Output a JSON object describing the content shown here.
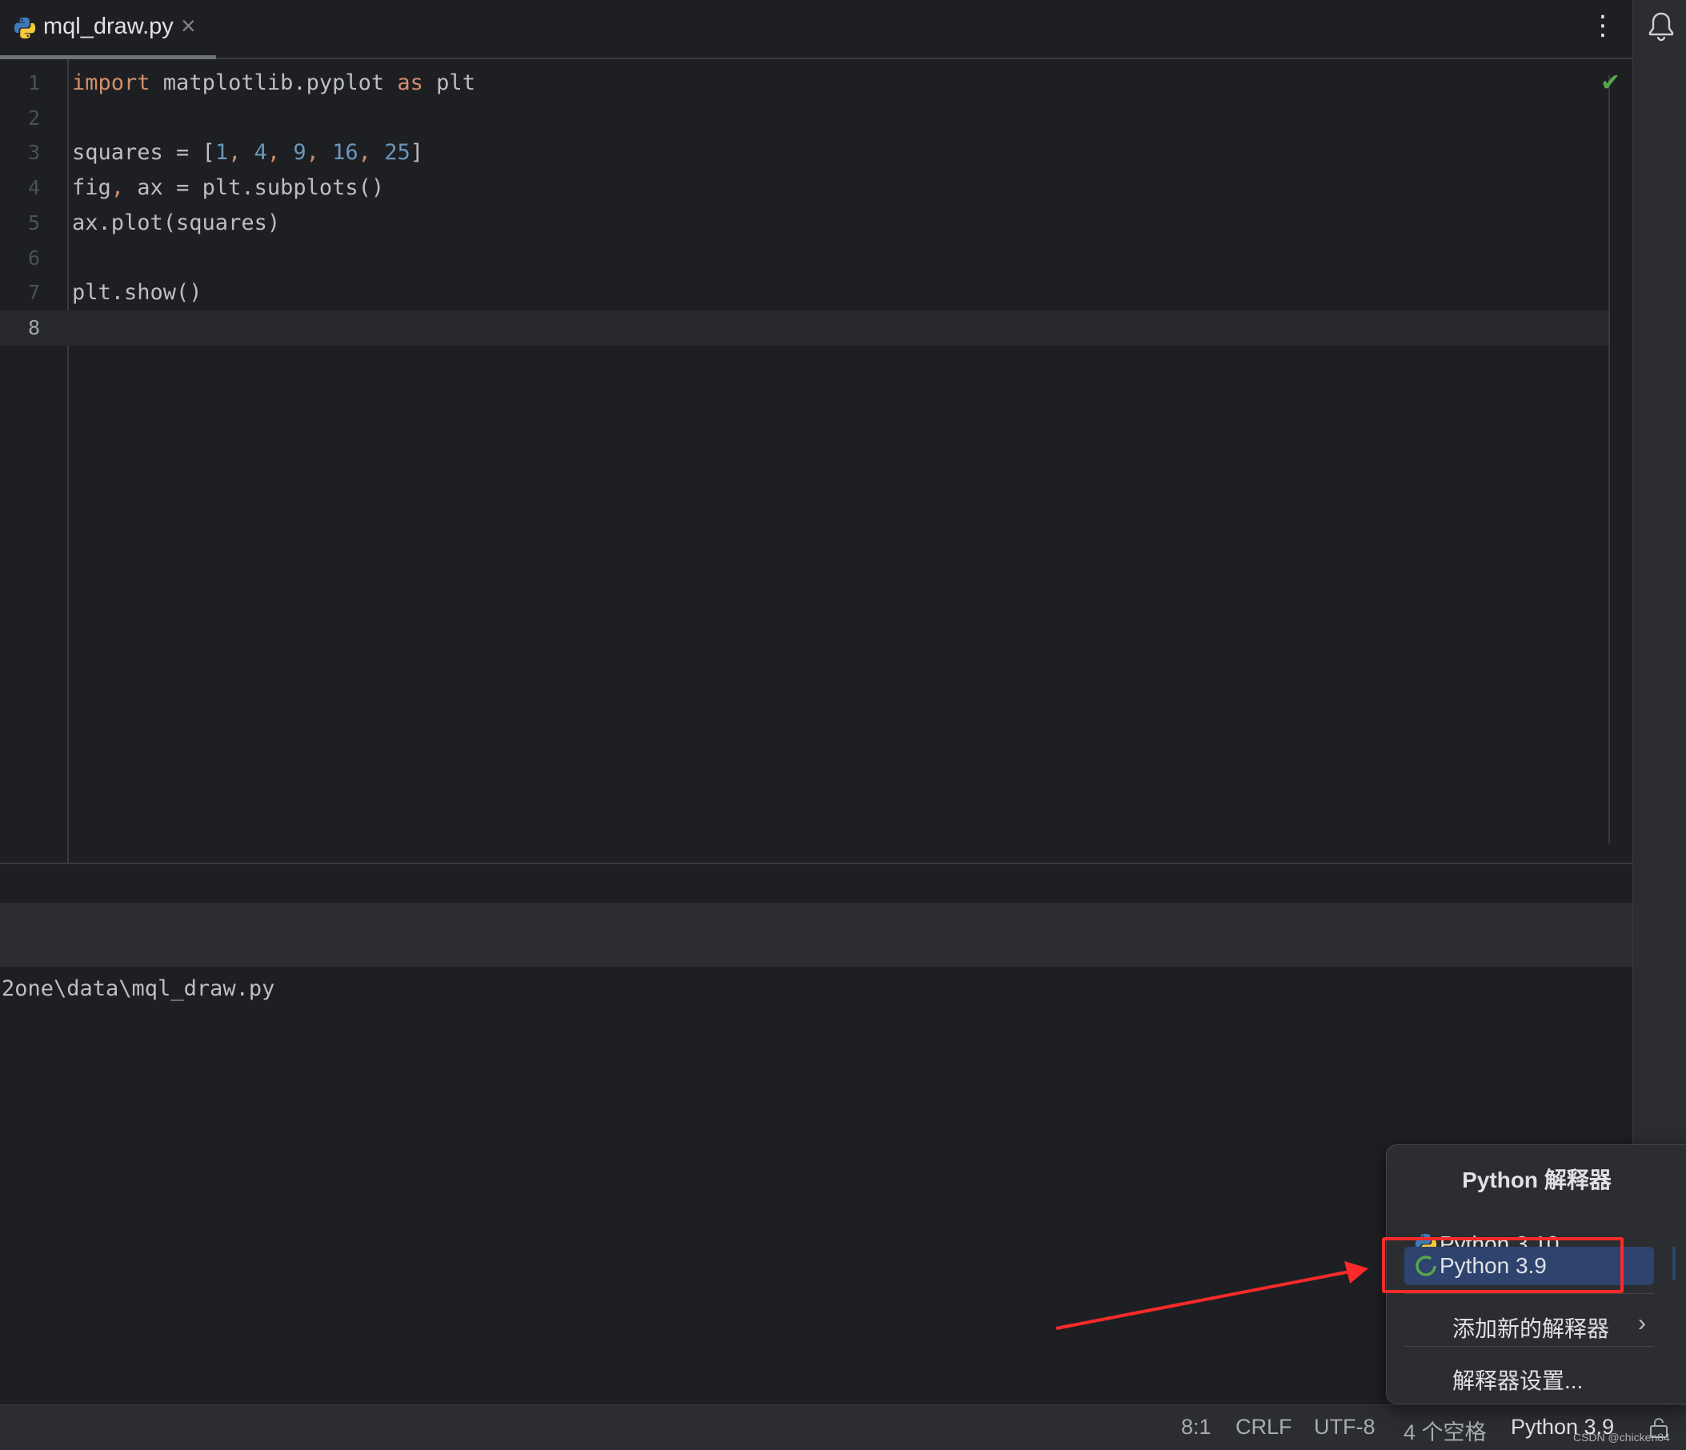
{
  "tab": {
    "filename": "mql_draw.py",
    "close_glyph": "×"
  },
  "editor": {
    "lines": [
      {
        "number": "1",
        "tokens": [
          {
            "t": "import",
            "k": "kw"
          },
          {
            "t": " matplotlib.pyplot ",
            "k": "plain"
          },
          {
            "t": "as",
            "k": "kw"
          },
          {
            "t": " plt",
            "k": "plain"
          }
        ]
      },
      {
        "number": "2",
        "tokens": []
      },
      {
        "number": "3",
        "tokens": [
          {
            "t": "squares = [",
            "k": "plain"
          },
          {
            "t": "1",
            "k": "num"
          },
          {
            "t": ", ",
            "k": "kw"
          },
          {
            "t": "4",
            "k": "num"
          },
          {
            "t": ", ",
            "k": "kw"
          },
          {
            "t": "9",
            "k": "num"
          },
          {
            "t": ", ",
            "k": "kw"
          },
          {
            "t": "16",
            "k": "num"
          },
          {
            "t": ", ",
            "k": "kw"
          },
          {
            "t": "25",
            "k": "num"
          },
          {
            "t": "]",
            "k": "plain"
          }
        ]
      },
      {
        "number": "4",
        "tokens": [
          {
            "t": "fig",
            "k": "plain"
          },
          {
            "t": ",",
            "k": "kw"
          },
          {
            "t": " ax = plt.subplots()",
            "k": "plain"
          }
        ]
      },
      {
        "number": "5",
        "tokens": [
          {
            "t": "ax.plot(squares)",
            "k": "plain"
          }
        ]
      },
      {
        "number": "6",
        "tokens": []
      },
      {
        "number": "7",
        "tokens": [
          {
            "t": "plt.show()",
            "k": "plain"
          }
        ]
      },
      {
        "number": "8",
        "tokens": []
      }
    ],
    "current_line": "8",
    "inspection_icon": "check-icon"
  },
  "console": {
    "text": "2one\\data\\mql_draw.py"
  },
  "status_bar": {
    "position": "8:1",
    "line_separator": "CRLF",
    "encoding": "UTF-8",
    "indent": "4 个空格",
    "interpreter": "Python 3.9",
    "watermark": "CSDN @chicken84"
  },
  "interpreter_popup": {
    "title": "Python 解释器",
    "items": [
      {
        "label": "Python 3.10",
        "icon": "python-icon",
        "selected": false
      },
      {
        "label": "Python 3.9",
        "icon": "loading-spinner-icon",
        "selected": true
      }
    ],
    "add_new": "添加新的解释器",
    "settings": "解释器设置..."
  },
  "colors": {
    "background": "#1e1f22",
    "keyword": "#cf8e6d",
    "number": "#6897bb",
    "selection": "#2e436e",
    "annotation": "#ff2a2a"
  }
}
